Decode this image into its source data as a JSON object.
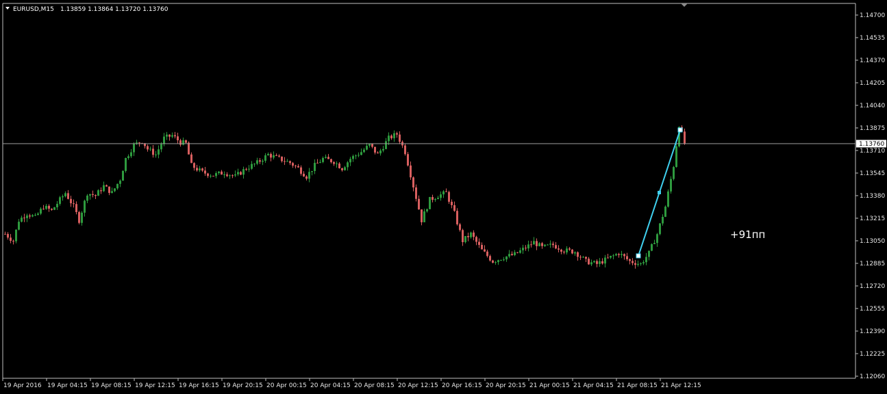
{
  "header": {
    "symbol_tf": "EURUSD,M15",
    "ohlc": "1.13859 1.13864 1.13720 1.13760"
  },
  "note": {
    "text": "+91пп"
  },
  "colors": {
    "background": "#000000",
    "frame": "#c0c0c0",
    "bull": "#2e9a3e",
    "bear": "#d85f5f",
    "trendline": "#3fd0ef",
    "price_line": "#a0a0a0"
  },
  "chart_data": {
    "type": "candlestick",
    "symbol": "EURUSD",
    "timeframe": "M15",
    "current_price": "1.13760",
    "ylim": [
      1.1206,
      1.1481
    ],
    "y_ticks": [
      "1.14700",
      "1.14535",
      "1.14370",
      "1.14205",
      "1.14040",
      "1.13875",
      "1.13710",
      "1.13545",
      "1.13380",
      "1.13215",
      "1.13050",
      "1.12885",
      "1.12720",
      "1.12555",
      "1.12390",
      "1.12225",
      "1.12060"
    ],
    "x_ticks": [
      "19 Apr 2016",
      "19 Apr 04:15",
      "19 Apr 08:15",
      "19 Apr 12:15",
      "19 Apr 16:15",
      "19 Apr 20:15",
      "20 Apr 00:15",
      "20 Apr 04:15",
      "20 Apr 08:15",
      "20 Apr 12:15",
      "20 Apr 16:15",
      "20 Apr 20:15",
      "21 Apr 00:15",
      "21 Apr 04:15",
      "21 Apr 08:15",
      "21 Apr 12:15"
    ],
    "close_path": [
      [
        0,
        1.131
      ],
      [
        3,
        1.1305
      ],
      [
        5,
        1.132
      ],
      [
        8,
        1.1325
      ],
      [
        11,
        1.1322
      ],
      [
        14,
        1.133
      ],
      [
        17,
        1.1327
      ],
      [
        20,
        1.1335
      ],
      [
        22,
        1.134
      ],
      [
        25,
        1.133
      ],
      [
        27,
        1.132
      ],
      [
        30,
        1.134
      ],
      [
        33,
        1.1338
      ],
      [
        36,
        1.1345
      ],
      [
        39,
        1.134
      ],
      [
        42,
        1.135
      ],
      [
        44,
        1.1365
      ],
      [
        47,
        1.1375
      ],
      [
        50,
        1.1378
      ],
      [
        52,
        1.1372
      ],
      [
        55,
        1.1368
      ],
      [
        58,
        1.138
      ],
      [
        61,
        1.1382
      ],
      [
        64,
        1.1377
      ],
      [
        66,
        1.1376
      ],
      [
        68,
        1.136
      ],
      [
        72,
        1.1355
      ],
      [
        76,
        1.1353
      ],
      [
        80,
        1.1355
      ],
      [
        84,
        1.1352
      ],
      [
        88,
        1.1358
      ],
      [
        92,
        1.1362
      ],
      [
        96,
        1.1368
      ],
      [
        100,
        1.1365
      ],
      [
        104,
        1.1362
      ],
      [
        107,
        1.1358
      ],
      [
        110,
        1.1352
      ],
      [
        113,
        1.136
      ],
      [
        116,
        1.1365
      ],
      [
        120,
        1.1363
      ],
      [
        123,
        1.1358
      ],
      [
        126,
        1.1365
      ],
      [
        130,
        1.137
      ],
      [
        133,
        1.1375
      ],
      [
        136,
        1.1368
      ],
      [
        140,
        1.138
      ],
      [
        143,
        1.1383
      ],
      [
        146,
        1.137
      ],
      [
        149,
        1.1345
      ],
      [
        152,
        1.132
      ],
      [
        155,
        1.1335
      ],
      [
        158,
        1.1338
      ],
      [
        161,
        1.134
      ],
      [
        164,
        1.1325
      ],
      [
        167,
        1.1305
      ],
      [
        170,
        1.131
      ],
      [
        174,
        1.1298
      ],
      [
        178,
        1.129
      ],
      [
        182,
        1.1293
      ],
      [
        186,
        1.1295
      ],
      [
        190,
        1.13
      ],
      [
        193,
        1.1304
      ],
      [
        196,
        1.13
      ],
      [
        200,
        1.1302
      ],
      [
        204,
        1.1298
      ],
      [
        208,
        1.1297
      ],
      [
        212,
        1.129
      ],
      [
        216,
        1.1288
      ],
      [
        220,
        1.1292
      ],
      [
        224,
        1.1296
      ],
      [
        228,
        1.129
      ],
      [
        232,
        1.1288
      ],
      [
        235,
        1.1296
      ],
      [
        238,
        1.131
      ],
      [
        241,
        1.133
      ],
      [
        244,
        1.136
      ],
      [
        246,
        1.139
      ],
      [
        248,
        1.1376
      ]
    ],
    "trendline": {
      "start": {
        "time": "21 Apr 08:30",
        "price": 1.129
      },
      "end": {
        "time": "21 Apr 12:45",
        "price": 1.1381
      },
      "pips": 91
    }
  }
}
